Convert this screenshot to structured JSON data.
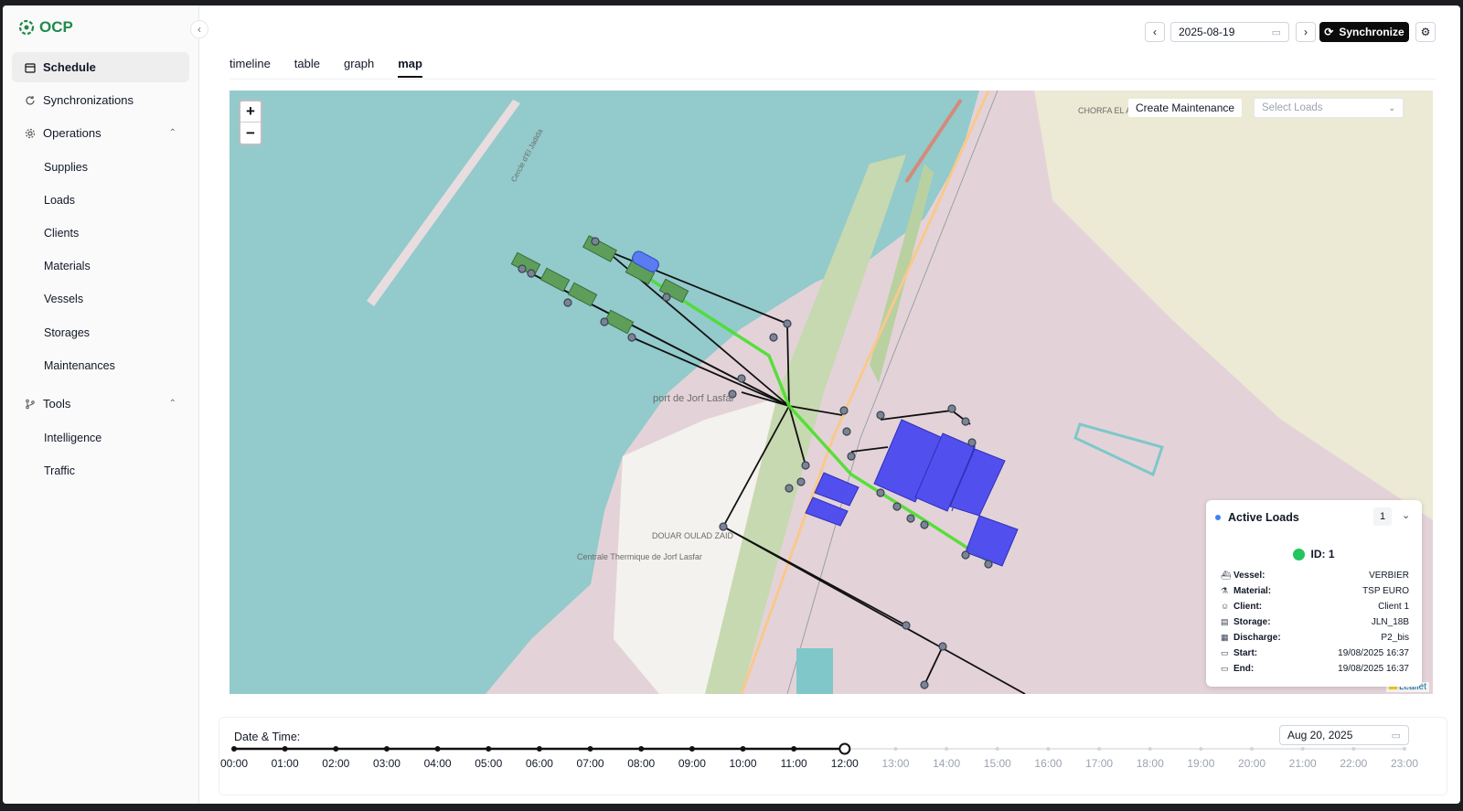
{
  "app": {
    "logo_text": "OCP",
    "collapse_icon": "chevron-left-icon"
  },
  "sidebar": {
    "items": [
      {
        "label": "Schedule",
        "icon": "calendar-icon",
        "active": true
      },
      {
        "label": "Synchronizations",
        "icon": "refresh-icon",
        "active": false
      },
      {
        "label": "Operations",
        "icon": "gear-icon",
        "expanded": true,
        "children": [
          "Supplies",
          "Loads",
          "Clients",
          "Materials",
          "Vessels",
          "Storages",
          "Maintenances"
        ]
      },
      {
        "label": "Tools",
        "icon": "branch-icon",
        "expanded": true,
        "children": [
          "Intelligence",
          "Traffic"
        ]
      }
    ]
  },
  "topbar": {
    "date_value": "2025-08-19",
    "sync_label": "Synchronize"
  },
  "tabs": [
    {
      "label": "timeline",
      "active": false
    },
    {
      "label": "table",
      "active": false
    },
    {
      "label": "graph",
      "active": false
    },
    {
      "label": "map",
      "active": true
    }
  ],
  "map": {
    "zoom_in": "+",
    "zoom_out": "−",
    "create_maintenance_label": "Create Maintenance",
    "select_loads_placeholder": "Select Loads",
    "attribution": "Leaflet",
    "labels": {
      "port": "port de Jorf Lasfar",
      "douar": "DOUAR OULAD ZAID",
      "centrale": "Centrale Thermique de Jorf Lasfar",
      "chorfa": "CHORFA EL AIN",
      "cercle": "Cercle d'El Jadida"
    },
    "colors": {
      "sea": "#93cacb",
      "land": "#e3d3d8",
      "route": "#000000",
      "active_route": "#4ade2c",
      "berth": "#5d9e5a",
      "storage": "#4a4af0",
      "node": "#7a8494"
    },
    "active_loads": {
      "title": "Active Loads",
      "count": "1",
      "load_id": "ID: 1",
      "rows": [
        {
          "key": "Vessel:",
          "value": "VERBIER",
          "icon": "ship-icon"
        },
        {
          "key": "Material:",
          "value": "TSP EURO",
          "icon": "flask-icon"
        },
        {
          "key": "Client:",
          "value": "Client 1",
          "icon": "user-icon"
        },
        {
          "key": "Storage:",
          "value": "JLN_18B",
          "icon": "database-icon"
        },
        {
          "key": "Discharge:",
          "value": "P2_bis",
          "icon": "grid-icon"
        },
        {
          "key": "Start:",
          "value": "19/08/2025 16:37",
          "icon": "calendar-icon"
        },
        {
          "key": "End:",
          "value": "19/08/2025 16:37",
          "icon": "calendar-icon"
        }
      ]
    }
  },
  "timebar": {
    "title": "Date & Time:",
    "date_value": "Aug 20, 2025",
    "hours": [
      "00:00",
      "01:00",
      "02:00",
      "03:00",
      "04:00",
      "05:00",
      "06:00",
      "07:00",
      "08:00",
      "09:00",
      "10:00",
      "11:00",
      "12:00",
      "13:00",
      "14:00",
      "15:00",
      "16:00",
      "17:00",
      "18:00",
      "19:00",
      "20:00",
      "21:00",
      "22:00",
      "23:00"
    ],
    "selected_hour_index": 12
  }
}
